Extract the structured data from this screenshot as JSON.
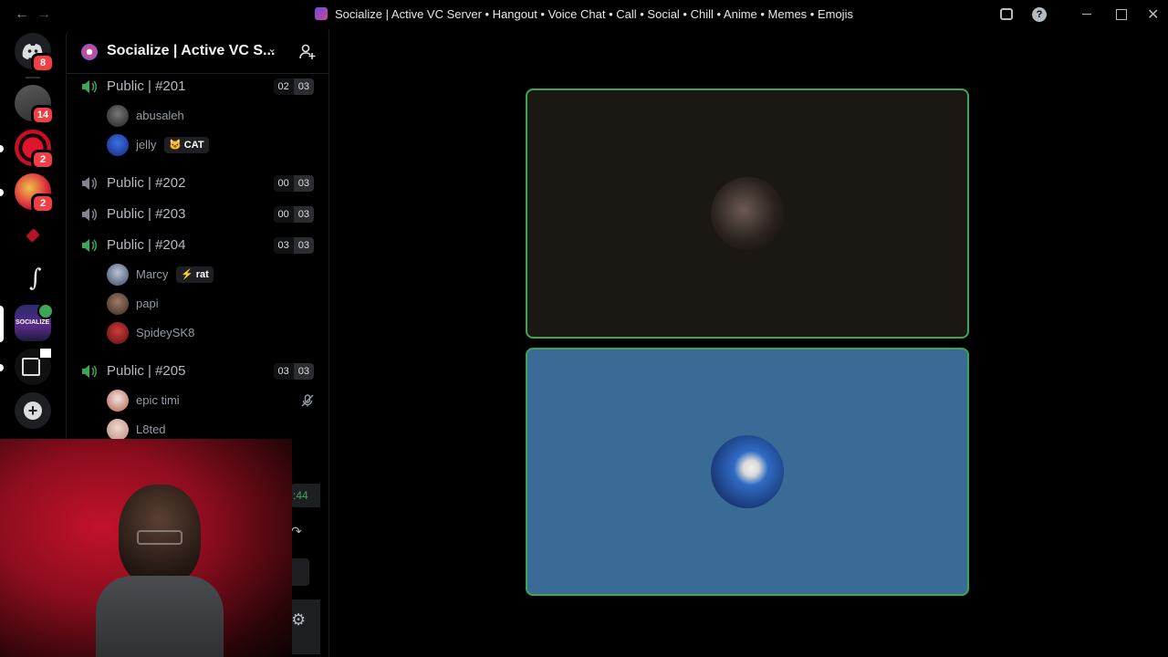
{
  "window": {
    "title": "Socialize | Active VC Server • Hangout • Voice Chat • Call • Social • Chill • Anime • Memes • Emojis",
    "back_icon": "arrow-left-icon",
    "forward_icon": "arrow-right-icon",
    "inbox_icon": "inbox-icon",
    "help_icon": "help-icon",
    "minimize_icon": "minimize-icon",
    "maximize_icon": "maximize-icon",
    "close_icon": "close-icon"
  },
  "rail": {
    "home_badge": "8",
    "servers": [
      {
        "badge": "14"
      },
      {
        "badge": "2"
      },
      {
        "badge": "2"
      },
      {
        "badge": ""
      },
      {
        "badge": ""
      },
      {
        "label": "SOCIALIZE",
        "badge": ""
      },
      {
        "badge": ""
      }
    ]
  },
  "server": {
    "name": "Socialize | Active VC S...",
    "invite_icon": "add-member-icon",
    "dropdown_icon": "chevron-down-icon"
  },
  "voice_channels": [
    {
      "name": "Public | #201",
      "count": "02",
      "limit": "03",
      "active": true,
      "users": [
        {
          "name": "abusaleh",
          "tag": ""
        },
        {
          "name": "jelly",
          "tag": "CAT",
          "tag_icon": "cat-icon"
        }
      ]
    },
    {
      "name": "Public | #202",
      "count": "00",
      "limit": "03",
      "active": false,
      "users": []
    },
    {
      "name": "Public | #203",
      "count": "00",
      "limit": "03",
      "active": false,
      "users": []
    },
    {
      "name": "Public | #204",
      "count": "03",
      "limit": "03",
      "active": true,
      "users": [
        {
          "name": "Marcy",
          "tag": "rat",
          "tag_icon": "lightning-icon"
        },
        {
          "name": "papi",
          "tag": ""
        },
        {
          "name": "SpideySK8",
          "tag": ""
        }
      ]
    },
    {
      "name": "Public | #205",
      "count": "03",
      "limit": "03",
      "active": true,
      "users": [
        {
          "name": "epic timi",
          "tag": "",
          "muted": true
        },
        {
          "name": "L8ted",
          "tag": ""
        }
      ]
    }
  ],
  "voice_panel": {
    "timer": ":44"
  },
  "colors": {
    "speaking": "#3fa556",
    "badge": "#f23f43",
    "tile_dark": "#1b1813",
    "tile_blue": "#3a6b96"
  }
}
